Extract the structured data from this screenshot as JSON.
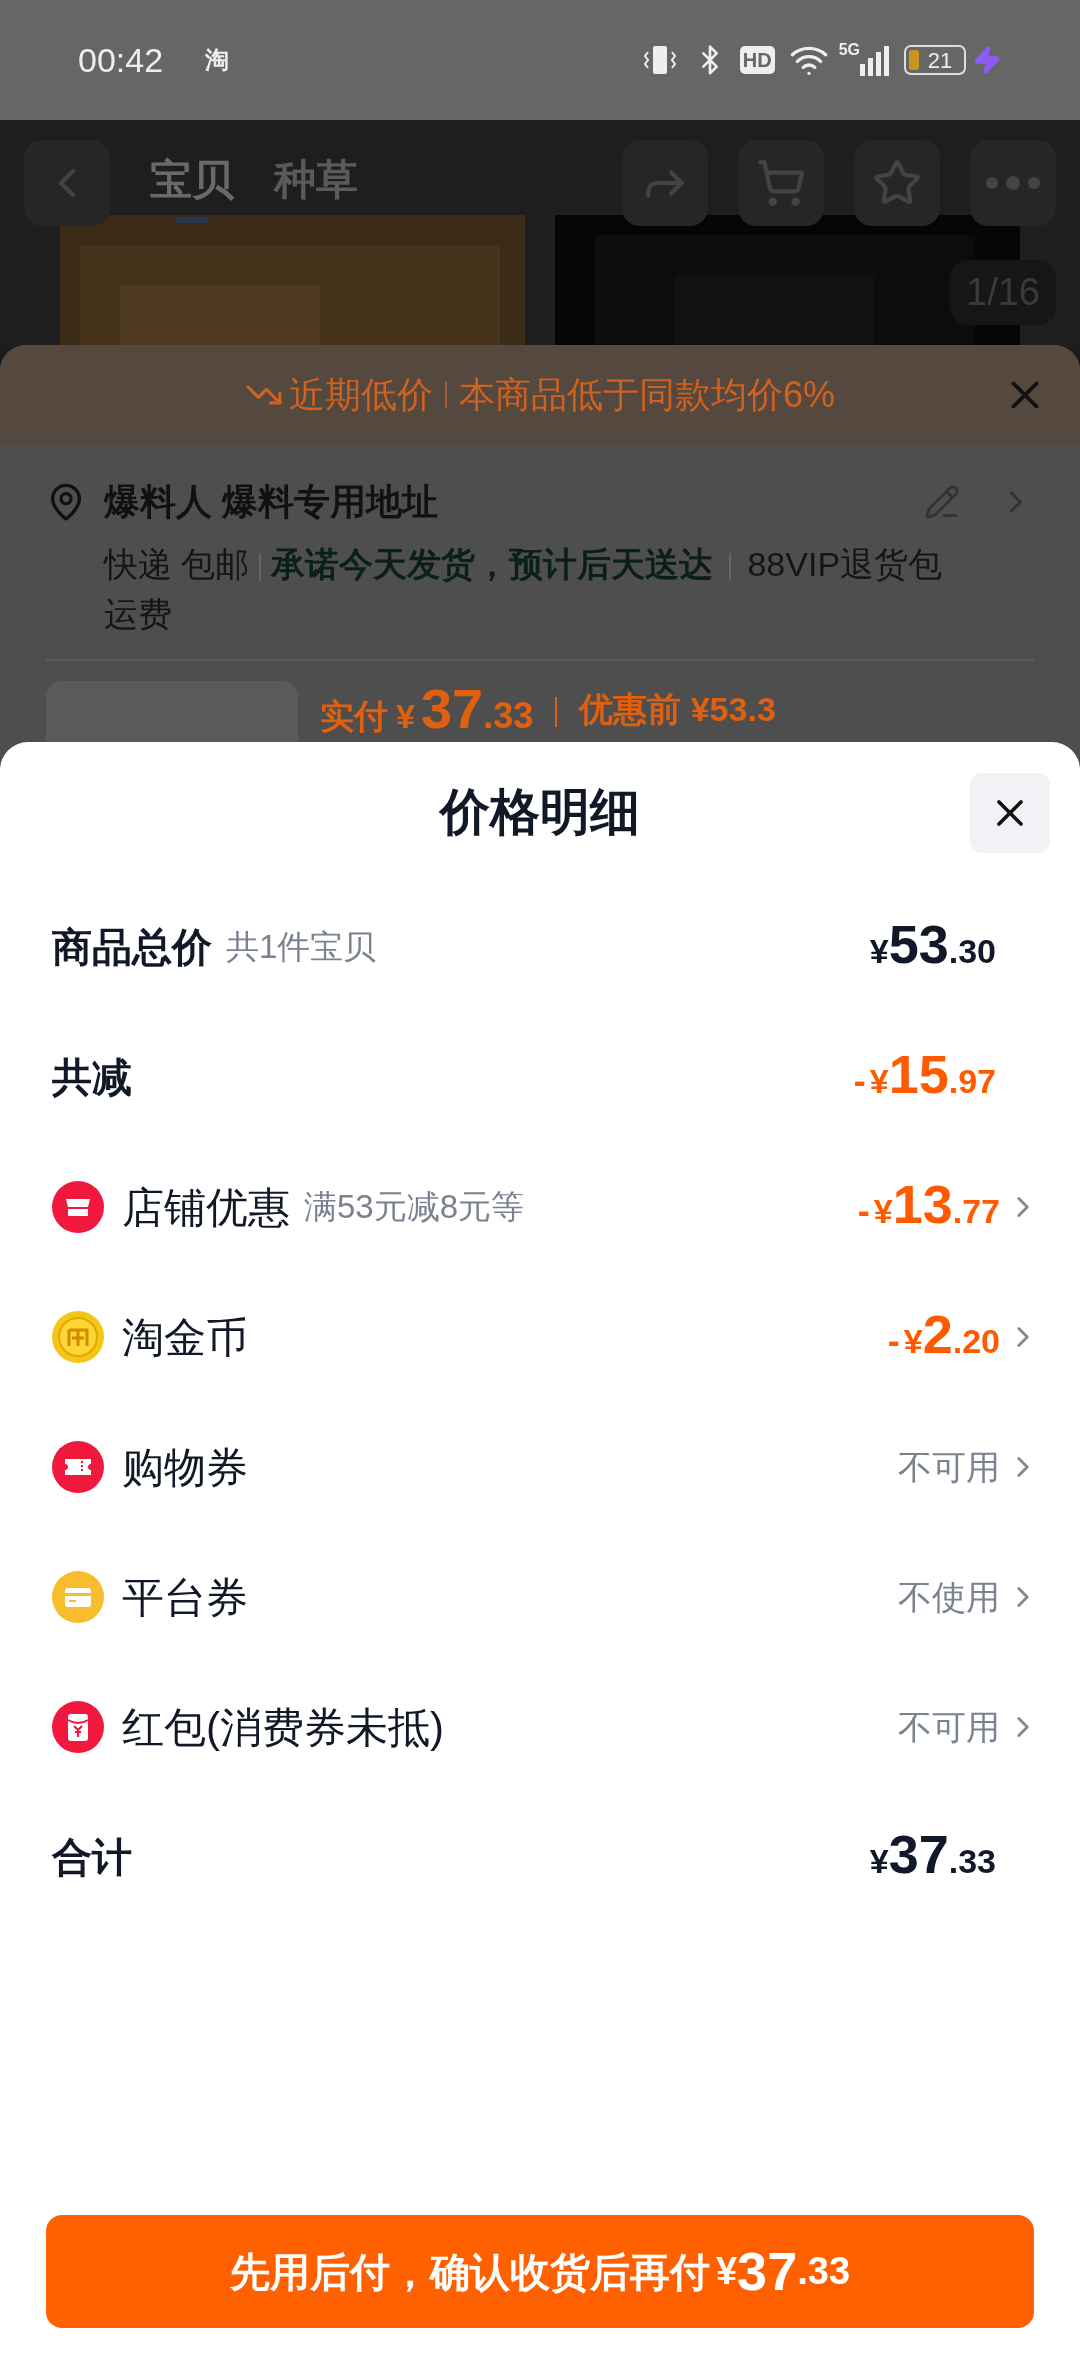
{
  "status_bar": {
    "time": "00:42",
    "app_badge": "淘",
    "hd": "HD",
    "network": "5G",
    "battery": "21"
  },
  "product_page": {
    "tabs": [
      {
        "label": "宝贝",
        "selected": true
      },
      {
        "label": "种草",
        "selected": false
      }
    ],
    "image_counter": "1/16",
    "banner": {
      "tag": "近期低价",
      "text": "本商品低于同款均价6%"
    },
    "address": {
      "name": "爆料人 爆料专用地址",
      "delivery": "快递 包邮",
      "promise": "承诺今天发货，预计后天送达",
      "service": "88VIP退货包运费"
    },
    "price": {
      "label": "实付",
      "currency": "¥",
      "integer": "37",
      "decimal": ".33",
      "before": "优惠前 ¥53.3"
    }
  },
  "price_detail": {
    "title": "价格明细",
    "rows": [
      {
        "kind": "summary",
        "label": "商品总价",
        "note": "共1件宝贝",
        "amount": {
          "currency": "¥",
          "integer": "53",
          "decimal": ".30"
        }
      },
      {
        "kind": "summary",
        "label": "共减",
        "amount": {
          "sign": "-",
          "currency": "¥",
          "integer": "15",
          "decimal": ".97"
        }
      },
      {
        "kind": "store",
        "label": "店铺优惠",
        "note": "满53元减8元等",
        "amount": {
          "sign": "-",
          "currency": "¥",
          "integer": "13",
          "decimal": ".77"
        }
      },
      {
        "kind": "coin",
        "label": "淘金币",
        "amount": {
          "sign": "-",
          "currency": "¥",
          "integer": "2",
          "decimal": ".20"
        }
      },
      {
        "kind": "ticket",
        "label": "购物券",
        "status": "不可用"
      },
      {
        "kind": "card",
        "label": "平台券",
        "status": "不使用"
      },
      {
        "kind": "envelope",
        "label": "红包(消费券未抵)",
        "status": "不可用"
      },
      {
        "kind": "summary",
        "label": "合计",
        "amount": {
          "currency": "¥",
          "integer": "37",
          "decimal": ".33"
        }
      }
    ],
    "pay_button": {
      "label": "先用后付，确认收货后再付",
      "currency": "¥",
      "integer": "37",
      "decimal": ".33"
    }
  }
}
